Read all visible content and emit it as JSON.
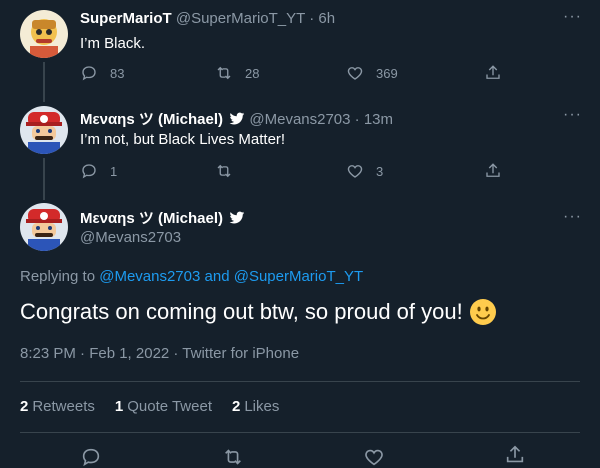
{
  "tweets": [
    {
      "name": "SuperMarioT",
      "handle": "@SuperMarioT_YT",
      "time": "· 6h",
      "text": "I’m Black.",
      "replies": "83",
      "retweets": "28",
      "likes": "369",
      "verified": false
    },
    {
      "name": "Μεναηs ツ (Michael)",
      "handle": "@Mevans2703",
      "time": "· 13m",
      "text": "I’m not, but Black Lives Matter!",
      "replies": "1",
      "retweets": "",
      "likes": "3",
      "verified": true
    }
  ],
  "main_tweet": {
    "name": "Μεναηs ツ (Michael)",
    "handle": "@Mevans2703",
    "verified": true,
    "replying_prefix": "Replying to",
    "replying_handle_1": "@Mevans2703",
    "replying_and": "and",
    "replying_handle_2": "@SuperMarioT_YT",
    "text": "Congrats on coming out btw, so proud of you!",
    "timestamp": "8:23 PM · Feb 1, 2022 · Twitter for iPhone",
    "stats": {
      "retweets_num": "2",
      "retweets_label": "Retweets",
      "quotes_num": "1",
      "quotes_label": "Quote Tweet",
      "likes_num": "2",
      "likes_label": "Likes"
    }
  },
  "more_glyph": "···",
  "colors": {
    "background": "#15202b",
    "secondary_text": "#8b98a5",
    "link": "#1d9bf0",
    "divider": "#38444d"
  }
}
